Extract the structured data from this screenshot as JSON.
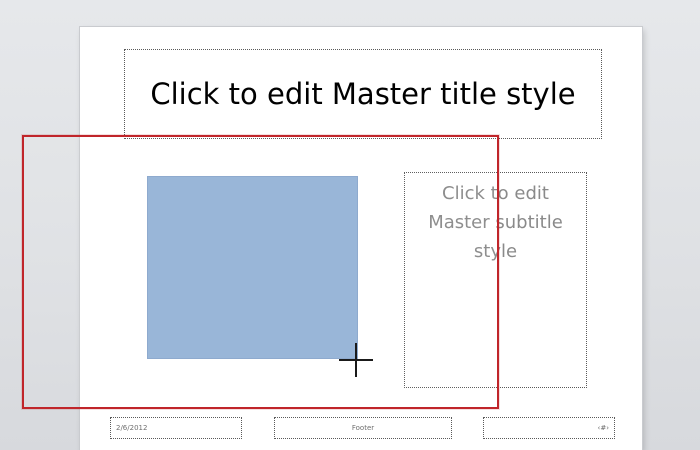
{
  "slide": {
    "title": "Click to edit Master title style",
    "subtitle": "Click to edit\nMaster subtitle\nstyle",
    "footer": {
      "date": "2/6/2012",
      "center": "Footer",
      "number": "‹#›"
    }
  },
  "colors": {
    "shape_fill": "#95b3d7",
    "selection_border": "#c0252a",
    "placeholder_text": "#8a8a8a"
  },
  "icons": {
    "cursor": "crosshair-icon"
  }
}
